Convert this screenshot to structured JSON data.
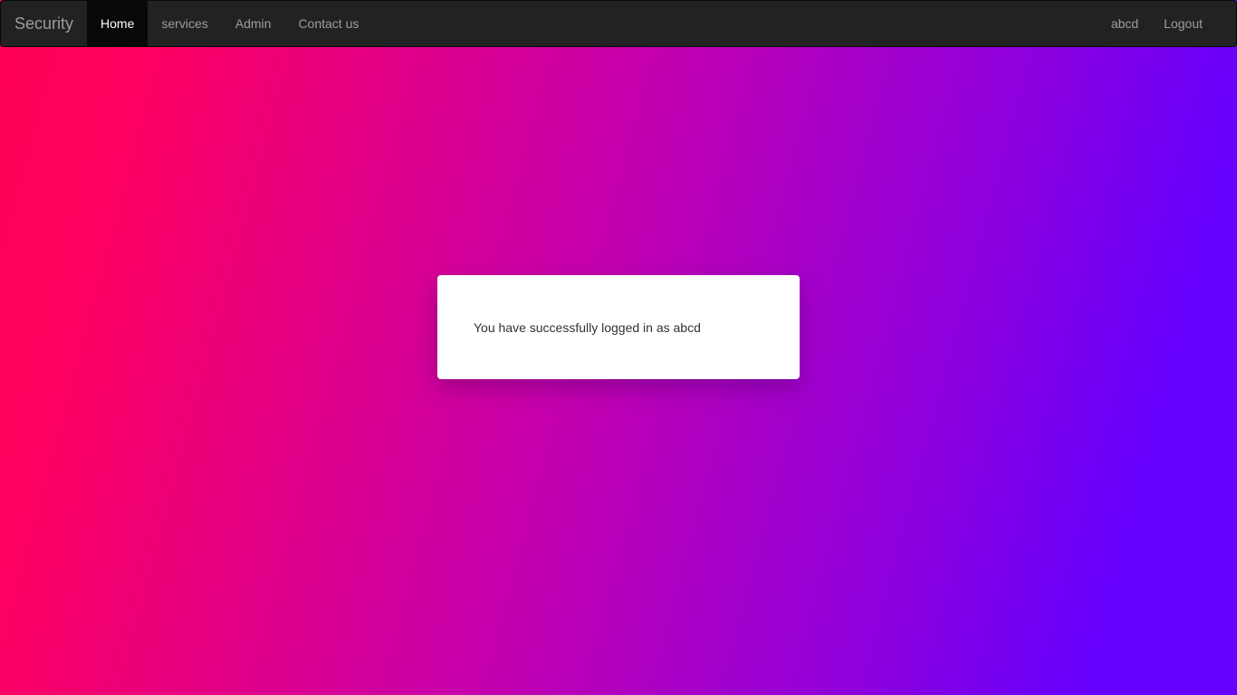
{
  "navbar": {
    "brand": "Security",
    "items": [
      {
        "label": "Home",
        "active": true
      },
      {
        "label": "services",
        "active": false
      },
      {
        "label": "Admin",
        "active": false
      },
      {
        "label": "Contact us",
        "active": false
      }
    ],
    "right_items": [
      {
        "label": "abcd"
      },
      {
        "label": "Logout"
      }
    ]
  },
  "main": {
    "message": "You have successfully logged in as abcd"
  },
  "colors": {
    "navbar_bg": "#222222",
    "gradient_start": "#ff0055",
    "gradient_end": "#6400ff",
    "panel_bg": "#ffffff"
  }
}
